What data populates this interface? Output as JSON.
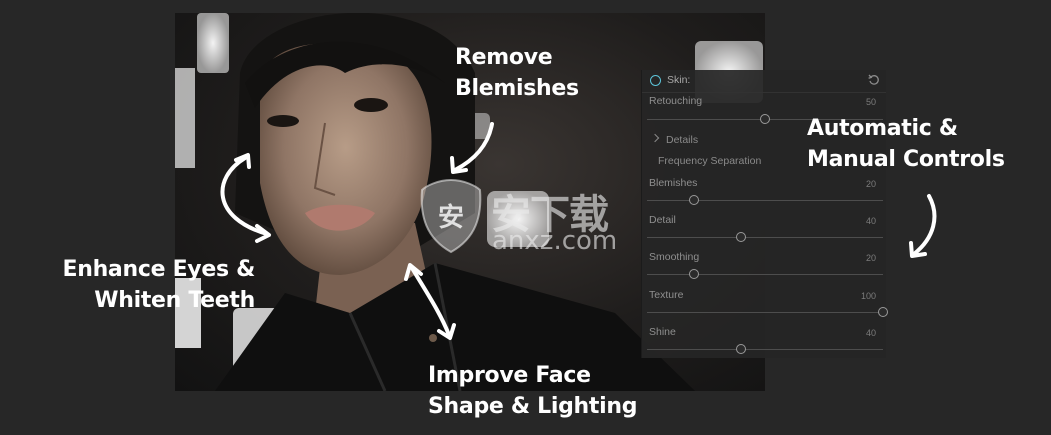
{
  "callouts": {
    "remove_blemishes": [
      "Remove",
      "Blemishes"
    ],
    "automatic_manual": [
      "Automatic &",
      "Manual Controls"
    ],
    "enhance_eyes": [
      "Enhance Eyes &",
      "Whiten Teeth"
    ],
    "improve_face": [
      "Improve Face",
      "Shape & Lighting"
    ]
  },
  "panel": {
    "title": "Skin:",
    "reset_icon": "reset-icon",
    "rows": {
      "retouching": {
        "label": "Retouching",
        "value": "50",
        "fraction": 0.5
      },
      "blemishes": {
        "label": "Blemishes",
        "value": "20",
        "fraction": 0.2
      },
      "detail": {
        "label": "Detail",
        "value": "40",
        "fraction": 0.4
      },
      "smoothing": {
        "label": "Smoothing",
        "value": "20",
        "fraction": 0.2
      },
      "texture": {
        "label": "Texture",
        "value": "100",
        "fraction": 1.0
      },
      "shine": {
        "label": "Shine",
        "value": "40",
        "fraction": 0.4
      }
    },
    "details_label": "Details",
    "frequency_label": "Frequency Separation"
  },
  "watermark": {
    "cn": "安下载",
    "domain": "anxz.com",
    "shield_glyph": "安"
  },
  "colors": {
    "background": "#272727",
    "panel": "#262626",
    "accent": "#5cc3d8",
    "callout_text": "#ffffff"
  }
}
